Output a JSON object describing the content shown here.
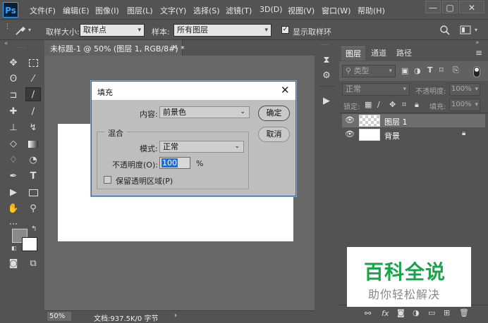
{
  "app": {
    "logo": "Ps"
  },
  "menubar": {
    "items": [
      "文件(F)",
      "编辑(E)",
      "图像(I)",
      "图层(L)",
      "文字(Y)",
      "选择(S)",
      "滤镜(T)",
      "3D(D)",
      "视图(V)",
      "窗口(W)",
      "帮助(H)"
    ]
  },
  "window_controls": {
    "minimize": "—",
    "restore": "▢",
    "close": "✕"
  },
  "options_bar": {
    "sample_size_label": "取样大小:",
    "sample_size_value": "取样点",
    "sample_label": "样本:",
    "sample_value": "所有图层",
    "show_ring_label": "显示取样环",
    "show_ring_checked": true
  },
  "document": {
    "tab_title": "未标题-1 @ 50% (图层 1, RGB/8#) *",
    "close": "×"
  },
  "status_bar": {
    "zoom": "50%",
    "doc_info": "文档:937.5K/0 字节",
    "arrow": "›"
  },
  "layers_panel": {
    "tabs": [
      "图层",
      "通道",
      "路径"
    ],
    "active_tab": "图层",
    "filter_label": "类型",
    "blend_mode": "正常",
    "opacity_label": "不透明度:",
    "opacity_value": "100%",
    "lock_label": "锁定:",
    "fill_label": "填充:",
    "fill_value": "100%",
    "layers": [
      {
        "name": "图层 1",
        "selected": true,
        "transparent": true
      },
      {
        "name": "背景",
        "selected": false,
        "locked": true
      }
    ]
  },
  "dialog": {
    "title": "填充",
    "content_label": "内容:",
    "content_value": "前景色",
    "ok_label": "确定",
    "cancel_label": "取消",
    "blend_group_label": "混合",
    "mode_label": "模式:",
    "mode_value": "正常",
    "opacity_label": "不透明度(O):",
    "opacity_value": "100",
    "opacity_unit": "%",
    "preserve_label": "保留透明区域(P)",
    "preserve_checked": false
  },
  "watermark": {
    "title": "百科全说",
    "subtitle": "助你轻松解决"
  },
  "colors": {
    "accent_green": "#1aa34a",
    "foreground": "#8a8a8a",
    "background": "#ffffff",
    "dialog_border": "#2e6fa8"
  }
}
